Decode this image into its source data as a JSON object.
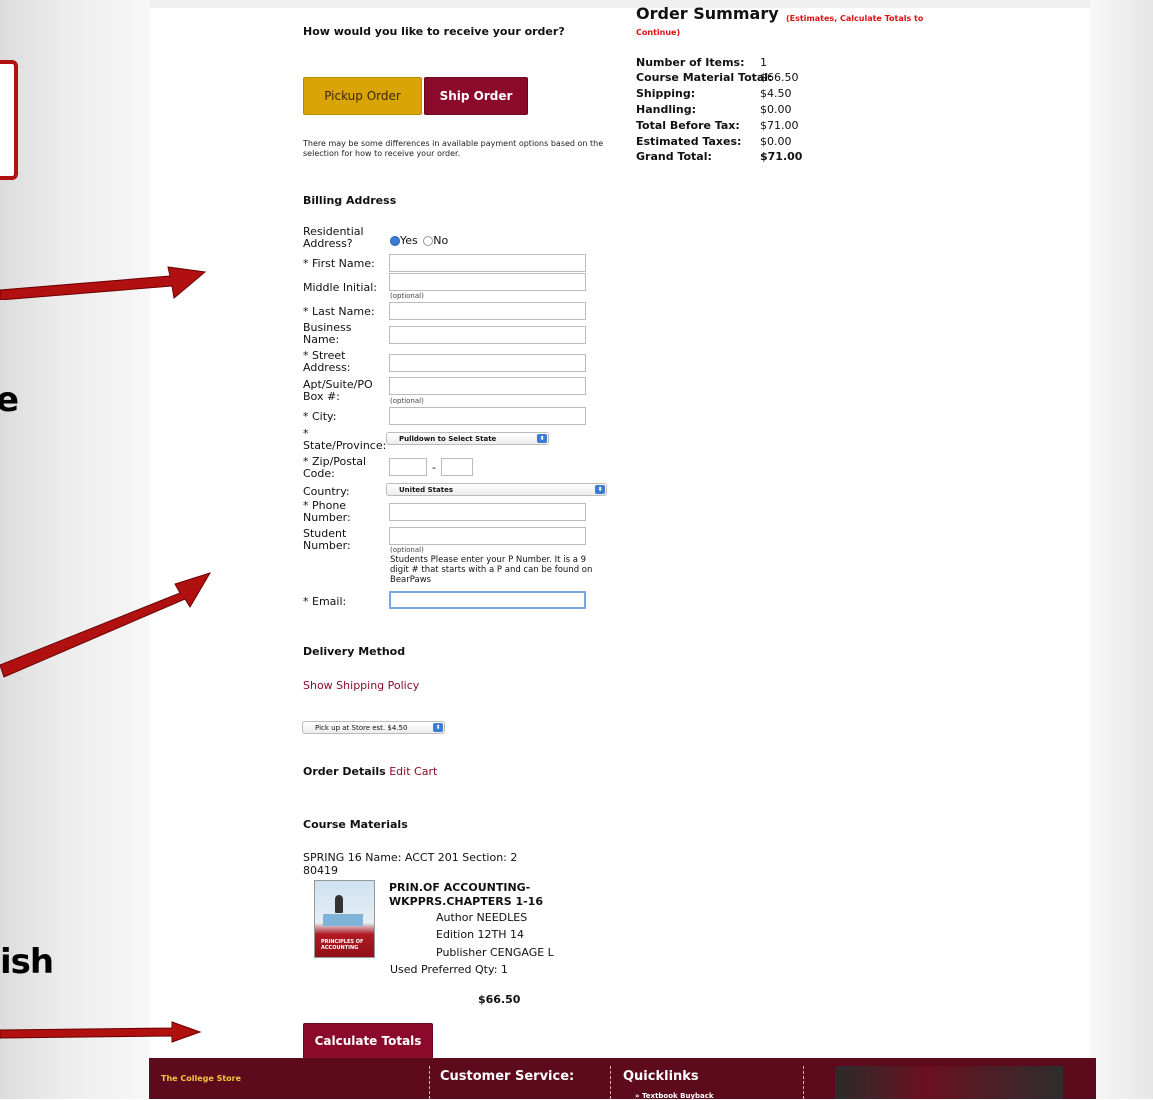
{
  "order_prompt": "How would you like to receive your order?",
  "buttons": {
    "pickup": "Pickup Order",
    "ship": "Ship Order",
    "calc": "Calculate Totals"
  },
  "payment_note": "There may be some differences in available payment options based on the selection for how to receive your order.",
  "billing": {
    "title": "Billing Address",
    "residential_label": "Residential Address?",
    "residential_yes": "Yes",
    "residential_no": "No",
    "first_name": "* First Name:",
    "middle_initial": "Middle Initial:",
    "last_name": "* Last Name:",
    "business_name": "Business Name:",
    "street_address": "* Street Address:",
    "apt": "Apt/Suite/PO Box #:",
    "city": "* City:",
    "state": "* State/Province:",
    "state_placeholder": "Pulldown to Select State",
    "zip": "* Zip/Postal Code:",
    "zip_sep": "-",
    "country": "Country:",
    "country_value": "United States",
    "phone": "* Phone Number:",
    "student_number": "Student Number:",
    "student_note": "Students Please enter your P Number. It is a 9 digit # that starts with a P and can be found on BearPaws",
    "email": "* Email:",
    "optional": "(optional)"
  },
  "delivery": {
    "title": "Delivery Method",
    "policy_link": "Show Shipping Policy",
    "method_value": "Pick up at Store est. $4.50"
  },
  "order_details": {
    "title": "Order Details",
    "edit_link": "Edit Cart"
  },
  "course": {
    "title": "Course Materials",
    "term_line": "SPRING 16 Name: ACCT 201 Section: 2",
    "section_num": "80419",
    "book_title_1": "PRIN.OF ACCOUNTING-",
    "book_title_2": "WKPPRS.CHAPTERS 1-16",
    "author": "Author NEEDLES",
    "edition": "Edition 12TH 14",
    "publisher": "Publisher CENGAGE L",
    "qty_line": "Used Preferred Qty: 1",
    "price": "$66.50",
    "cover_text": "PRINCIPLES OF ACCOUNTING"
  },
  "summary": {
    "title": "Order Summary",
    "est_note": "(Estimates, Calculate Totals to Continue)",
    "rows": [
      {
        "label": "Number of Items:",
        "value": "1"
      },
      {
        "label": "Course Material Total:",
        "value": "$66.50"
      },
      {
        "label": "Shipping:",
        "value": "$4.50"
      },
      {
        "label": "Handling:",
        "value": "$0.00"
      },
      {
        "label": "Total Before Tax:",
        "value": "$71.00"
      },
      {
        "label": "Estimated Taxes:",
        "value": "$0.00"
      },
      {
        "label": "Grand Total:",
        "value": "$71.00"
      }
    ]
  },
  "footer": {
    "college_store": "The College Store",
    "customer_service": "Customer Service:",
    "quicklinks": "Quicklinks",
    "quicklink_1": "» Textbook Buyback"
  },
  "callouts": {
    "letter_e": "e",
    "letters_ish": "ish"
  },
  "colors": {
    "maroon": "#8b0a2b",
    "gold": "#d9a404",
    "arrow": "#b01010",
    "footer": "#5c0a1c"
  }
}
